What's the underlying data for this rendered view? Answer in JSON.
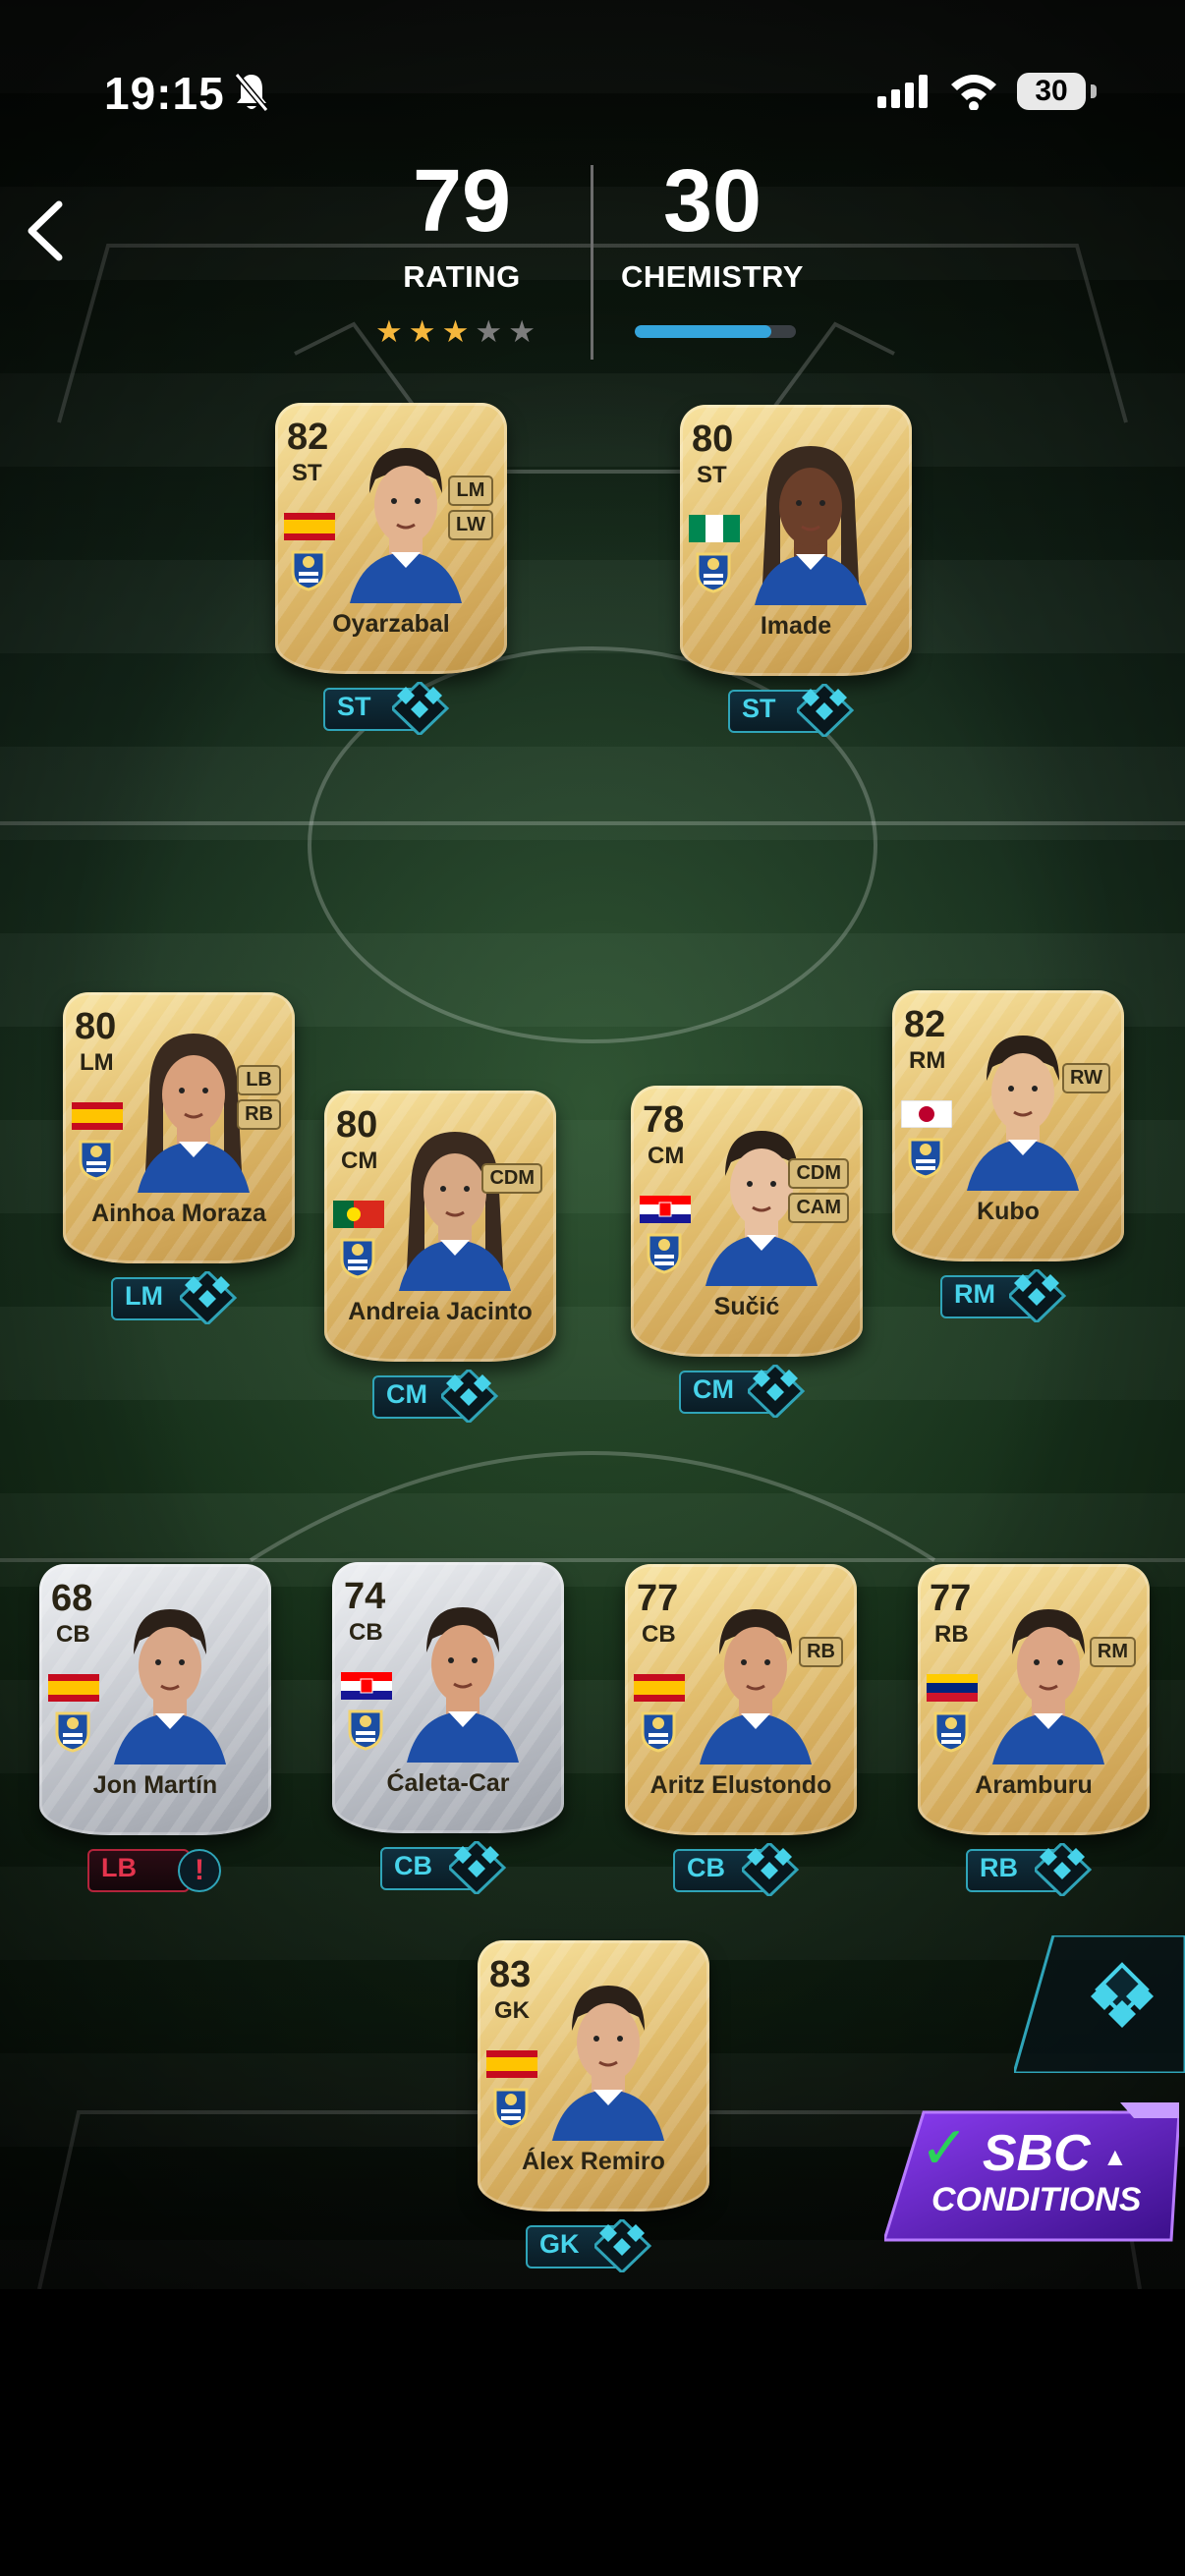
{
  "status_bar": {
    "time": "19:15",
    "battery": "30"
  },
  "header": {
    "rating_value": "79",
    "rating_label": "RATING",
    "chemistry_value": "30",
    "chemistry_label": "CHEMISTRY",
    "stars": {
      "filled": 3,
      "total": 5
    },
    "chemistry_progress": 0.85
  },
  "players": [
    {
      "name": "Oyarzabal",
      "rating": "82",
      "position": "ST",
      "alt_positions": [
        "LM",
        "LW"
      ],
      "slot": "ST",
      "card": "gold",
      "flag": "spain",
      "chem": 3
    },
    {
      "name": "Imade",
      "rating": "80",
      "position": "ST",
      "alt_positions": [],
      "slot": "ST",
      "card": "gold",
      "flag": "nigeria",
      "chem": 3
    },
    {
      "name": "Ainhoa Moraza",
      "rating": "80",
      "position": "LM",
      "alt_positions": [
        "LB",
        "RB"
      ],
      "slot": "LM",
      "card": "gold",
      "flag": "spain",
      "chem": 3
    },
    {
      "name": "Andreia Jacinto",
      "rating": "80",
      "position": "CM",
      "alt_positions": [
        "CDM"
      ],
      "slot": "CM",
      "card": "gold",
      "flag": "portugal",
      "chem": 3
    },
    {
      "name": "Sučić",
      "rating": "78",
      "position": "CM",
      "alt_positions": [
        "CDM",
        "CAM"
      ],
      "slot": "CM",
      "card": "gold",
      "flag": "croatia",
      "chem": 3
    },
    {
      "name": "Kubo",
      "rating": "82",
      "position": "RM",
      "alt_positions": [
        "RW"
      ],
      "slot": "RM",
      "card": "gold",
      "flag": "japan",
      "chem": 3
    },
    {
      "name": "Jon Martín",
      "rating": "68",
      "position": "CB",
      "alt_positions": [],
      "slot": "LB",
      "card": "silver",
      "flag": "spain",
      "chem": 0,
      "warning": "!"
    },
    {
      "name": "Ćaleta-Car",
      "rating": "74",
      "position": "CB",
      "alt_positions": [],
      "slot": "CB",
      "card": "silver",
      "flag": "croatia",
      "chem": 3
    },
    {
      "name": "Aritz Elustondo",
      "rating": "77",
      "position": "CB",
      "alt_positions": [
        "RB"
      ],
      "slot": "CB",
      "card": "gold",
      "flag": "spain",
      "chem": 3
    },
    {
      "name": "Aramburu",
      "rating": "77",
      "position": "RB",
      "alt_positions": [
        "RM"
      ],
      "slot": "RB",
      "card": "gold",
      "flag": "venezuela",
      "chem": 3
    },
    {
      "name": "Álex Remiro",
      "rating": "83",
      "position": "GK",
      "alt_positions": [],
      "slot": "GK",
      "card": "gold",
      "flag": "spain",
      "chem": 3
    }
  ],
  "sbc_button": {
    "line1": "SBC",
    "line2": "CONDITIONS"
  },
  "colors": {
    "accent": "#47d3ea",
    "gold_card": "#e1bd6d",
    "silver_card": "#c9ccd2",
    "warning": "#e3344d",
    "sbc": "#6d2bd1"
  }
}
